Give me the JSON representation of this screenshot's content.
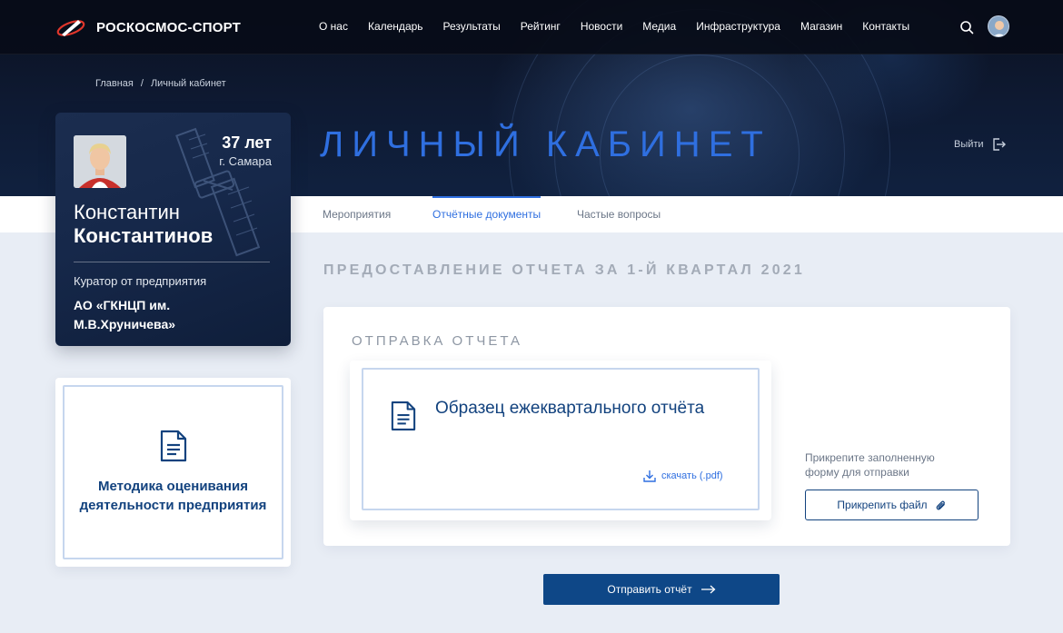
{
  "brand": {
    "name": "РОСКОСМОС-СПОРТ"
  },
  "nav": {
    "items": [
      "О нас",
      "Календарь",
      "Результаты",
      "Рейтинг",
      "Новости",
      "Медиа",
      "Инфраструктура",
      "Магазин",
      "Контакты"
    ]
  },
  "breadcrumb": {
    "home": "Главная",
    "separator": "/",
    "current": "Личный кабинет"
  },
  "page": {
    "title": "ЛИЧНЫЙ КАБИНЕТ",
    "logout_label": "Выйти"
  },
  "tabs": [
    {
      "label": "Мероприятия",
      "active": false
    },
    {
      "label": "Отчётные документы",
      "active": true
    },
    {
      "label": "Частые вопросы",
      "active": false
    }
  ],
  "profile": {
    "age": "37 лет",
    "city": "г. Самара",
    "first_name": "Константин",
    "last_name": "Константинов",
    "role": "Куратор от предприятия",
    "organization": "АО «ГКНЦП им. М.В.Хруничева»"
  },
  "method_card": {
    "label": "Методика оценивания деятельности предприятия",
    "icon": "document-icon"
  },
  "report": {
    "section_title": "ПРЕДОСТАВЛЕНИЕ ОТЧЕТА ЗА 1-Й КВАРТАЛ 2021",
    "panel_title": "ОТПРАВКА ОТЧЕТА",
    "sample_title": "Образец ежеквартального отчёта",
    "download_label": "скачать (.pdf)",
    "attach_hint": "Прикрепите заполненную форму для отправки",
    "attach_button": "Прикрепить файл",
    "submit_button": "Отправить отчёт"
  },
  "colors": {
    "accent": "#2f6fe0",
    "primary_dark": "#0e4787",
    "text_dark_blue": "#12427e",
    "header_bg": "#0b1120",
    "page_bg": "#e8edf5"
  }
}
